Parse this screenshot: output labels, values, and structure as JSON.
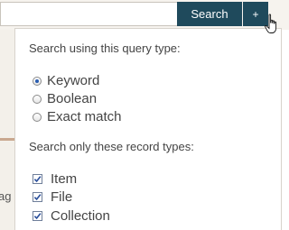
{
  "search": {
    "value": "",
    "button_label": "Search",
    "advanced_label": "+"
  },
  "dropdown": {
    "query_type_title": "Search using this query type:",
    "query_types": [
      {
        "label": "Keyword",
        "checked": true
      },
      {
        "label": "Boolean",
        "checked": false
      },
      {
        "label": "Exact match",
        "checked": false
      }
    ],
    "record_types_title": "Search only these record types:",
    "record_types": [
      {
        "label": "Item",
        "checked": true
      },
      {
        "label": "File",
        "checked": true
      },
      {
        "label": "Collection",
        "checked": true
      }
    ]
  },
  "background": {
    "clipped_text": "ag"
  },
  "colors": {
    "button": "#1f4a5c",
    "radio_dot": "#2a5db0",
    "checkmark": "#2a4f9c"
  },
  "icons": {
    "cursor": "hand-pointer-icon",
    "check": "checkmark-icon"
  }
}
